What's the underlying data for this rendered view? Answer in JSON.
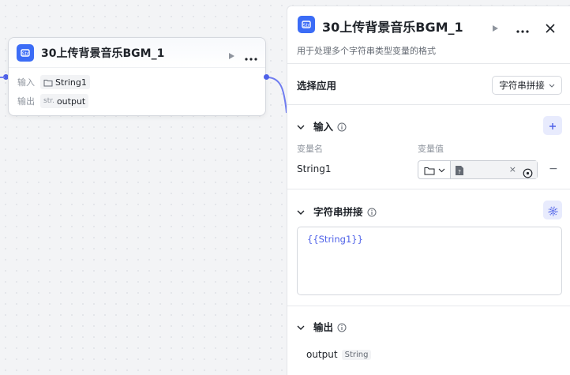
{
  "node": {
    "title": "30上传背景音乐BGM_1",
    "input_label": "输入",
    "input_var": "String1",
    "output_label": "输出",
    "output_type_prefix": "str.",
    "output_var": "output"
  },
  "panel": {
    "title": "30上传背景音乐BGM_1",
    "description": "用于处理多个字符串类型变量的格式",
    "select_app": {
      "label": "选择应用",
      "value": "字符串拼接"
    },
    "input_section": {
      "title": "输入",
      "col_name": "变量名",
      "col_value": "变量值",
      "rows": [
        {
          "name": "String1",
          "clear": "×",
          "remove": "−"
        }
      ]
    },
    "concat_section": {
      "title": "字符串拼接",
      "template": "{{String1}}"
    },
    "output_section": {
      "title": "输出",
      "var": "output",
      "type": "String"
    }
  },
  "colors": {
    "accent": "#4e61e8",
    "logo": "#3b6cf6"
  },
  "icons": [
    "app-logo-icon",
    "play-icon",
    "more-icon",
    "close-icon",
    "folder-icon",
    "chevron-down-icon",
    "chevron-icon",
    "info-icon",
    "plus-icon",
    "file-unknown-icon",
    "target-icon",
    "gear-icon"
  ]
}
